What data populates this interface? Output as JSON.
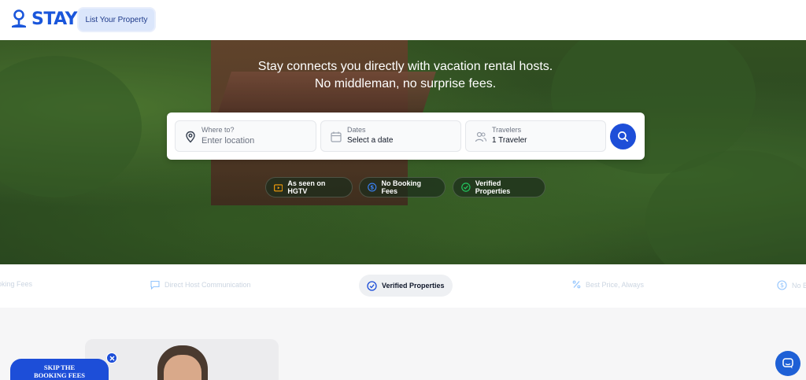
{
  "header": {
    "logo_text": "STAY",
    "list_property_label": "List Your Property"
  },
  "hero": {
    "tagline_line1": "Stay connects you directly with vacation rental hosts.",
    "tagline_line2": "No middleman, no surprise fees."
  },
  "search": {
    "location": {
      "label": "Where to?",
      "placeholder": "Enter location",
      "icon": "map-pin-icon"
    },
    "dates": {
      "label": "Dates",
      "value": "Select a date",
      "icon": "calendar-icon"
    },
    "travelers": {
      "label": "Travelers",
      "value": "1 Traveler",
      "icon": "users-icon"
    },
    "button_icon": "search-icon"
  },
  "badges": [
    {
      "label": "As seen on HGTV",
      "icon": "tv-icon",
      "color": "#f59e0b"
    },
    {
      "label": "No Booking Fees",
      "icon": "dollar-circle-icon",
      "color": "#3b82f6"
    },
    {
      "label": "Verified Properties",
      "icon": "check-circle-icon",
      "color": "#22c55e"
    }
  ],
  "features": {
    "items": [
      {
        "label": "oking Fees",
        "icon": ""
      },
      {
        "label": "Direct Host Communication",
        "icon": "message-icon"
      },
      {
        "label": "Verified Properties",
        "icon": "badge-check-icon",
        "active": true
      },
      {
        "label": "Best Price, Always",
        "icon": "percent-icon"
      },
      {
        "label": "No B",
        "icon": "dollar-circle-icon"
      }
    ]
  },
  "promo": {
    "skip_line1": "SKIP THE",
    "skip_line2": "BOOKING FEES"
  },
  "colors": {
    "brand": "#1a56db",
    "primary_button": "#1d4ed8"
  }
}
